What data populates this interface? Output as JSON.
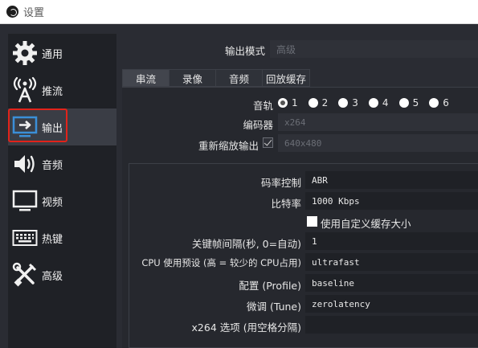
{
  "window": {
    "title": "设置"
  },
  "sidebar": {
    "items": [
      {
        "label": "通用",
        "icon": "gear-icon"
      },
      {
        "label": "推流",
        "icon": "broadcast-antenna-icon"
      },
      {
        "label": "输出",
        "icon": "output-monitor-icon"
      },
      {
        "label": "音频",
        "icon": "speaker-icon"
      },
      {
        "label": "视频",
        "icon": "monitor-icon"
      },
      {
        "label": "热键",
        "icon": "keyboard-icon"
      },
      {
        "label": "高级",
        "icon": "tools-icon"
      }
    ],
    "selected_index": 2
  },
  "output": {
    "mode_label": "输出模式",
    "mode_value": "高级",
    "tabs": [
      "串流",
      "录像",
      "音频",
      "回放缓存"
    ],
    "active_tab": 0,
    "track_label": "音轨",
    "tracks": [
      "1",
      "2",
      "3",
      "4",
      "5",
      "6"
    ],
    "selected_track": 0,
    "encoder_label": "编码器",
    "encoder_value": "x264",
    "rescale_label": "重新缩放输出",
    "rescale_value": "640x480",
    "rate_control_label": "码率控制",
    "rate_control_value": "ABR",
    "bitrate_label": "比特率",
    "bitrate_value": "1000 Kbps",
    "custom_buffer_label": "使用自定义缓存大小",
    "keyframe_label": "关键帧间隔(秒, 0=自动)",
    "keyframe_value": "1",
    "cpu_preset_label": "CPU 使用预设 (高 = 较少的 CPU占用)",
    "cpu_preset_value": "ultrafast",
    "profile_label": "配置 (Profile)",
    "profile_value": "baseline",
    "tune_label": "微调 (Tune)",
    "tune_value": "zerolatency",
    "x264_options_label": "x264 选项 (用空格分隔)",
    "x264_options_value": ""
  }
}
